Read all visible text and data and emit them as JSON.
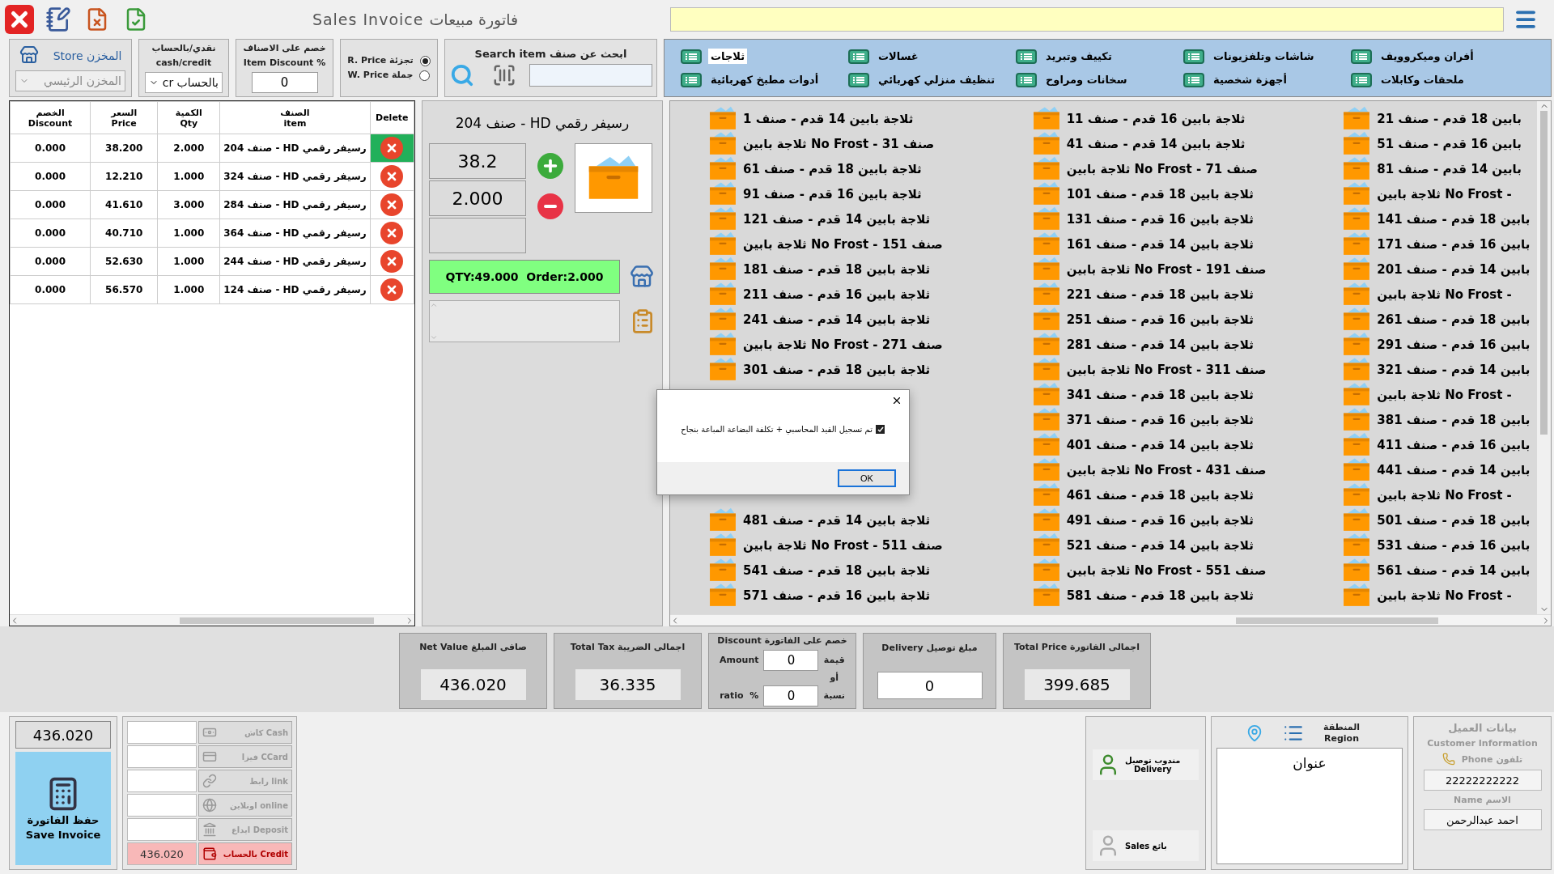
{
  "window": {
    "title": "Sales Invoice فاتورة مبيعات"
  },
  "store": {
    "label": "Store المخزن",
    "value": "المخزن الرئيسي",
    "disabled": true
  },
  "payment_type": {
    "label_ar": "نقدي/بالحساب",
    "label_en": "cash/credit",
    "value": "cr بالحساب"
  },
  "item_discount": {
    "label_ar": "خصم على الاصناف",
    "label_en": "Item Discount %",
    "value": "0"
  },
  "price_type": [
    {
      "label": "R. Price تجزئة",
      "selected": true
    },
    {
      "label": "W. Price جملة",
      "selected": false
    }
  ],
  "search": {
    "label": "Search item ابحث عن صنف"
  },
  "categories": [
    {
      "label": "أفران وميكروويف",
      "selected": false
    },
    {
      "label": "شاشات وتلفزيونات",
      "selected": false
    },
    {
      "label": "تكييف وتبريد",
      "selected": false
    },
    {
      "label": "غسالات",
      "selected": false
    },
    {
      "label": "ثلاجات",
      "selected": true
    },
    {
      "label": "ملحقات وكابلات",
      "selected": false
    },
    {
      "label": "أجهزة شخصية",
      "selected": false
    },
    {
      "label": "سخانات ومراوح",
      "selected": false
    },
    {
      "label": "تنظيف منزلي كهربائي",
      "selected": false
    },
    {
      "label": "أدوات مطبخ كهربائية",
      "selected": false
    }
  ],
  "table": {
    "columns": [
      {
        "en": "Delete"
      },
      {
        "ar": "الصنف",
        "en": "item"
      },
      {
        "ar": "الكمية",
        "en": "Qty"
      },
      {
        "ar": "السعر",
        "en": "Price"
      },
      {
        "ar": "الخصم",
        "en": "Discount"
      }
    ],
    "rows": [
      {
        "discount": "0.000",
        "price": "38.200",
        "qty": "2.000",
        "item": "رسيفر رقمي HD - صنف 204",
        "selected": true
      },
      {
        "discount": "0.000",
        "price": "12.210",
        "qty": "1.000",
        "item": "رسيفر رقمي HD - صنف 324",
        "selected": false
      },
      {
        "discount": "0.000",
        "price": "41.610",
        "qty": "3.000",
        "item": "رسيفر رقمي HD - صنف 284",
        "selected": false
      },
      {
        "discount": "0.000",
        "price": "40.710",
        "qty": "1.000",
        "item": "رسيفر رقمي HD - صنف 364",
        "selected": false
      },
      {
        "discount": "0.000",
        "price": "52.630",
        "qty": "1.000",
        "item": "رسيفر رقمي HD - صنف 244",
        "selected": false
      },
      {
        "discount": "0.000",
        "price": "56.570",
        "qty": "1.000",
        "item": "رسيفر رقمي HD - صنف 124",
        "selected": false
      }
    ]
  },
  "item_panel": {
    "title": "رسيفر رقمي HD - صنف 204",
    "price": "38.2",
    "qty": "2.000",
    "stock": "QTY:49.000  Order:2.000"
  },
  "products": {
    "column_1_top": [
      "ثلاجة بابين 14 قدم - صنف 1",
      "صنف No Frost - 31 ثلاجة بابين",
      "ثلاجة بابين 18 قدم - صنف 61",
      "ثلاجة بابين 16 قدم - صنف 91",
      "ثلاجة بابين 14 قدم - صنف 121",
      "صنف No Frost - 151 ثلاجة بابين",
      "ثلاجة بابين 18 قدم - صنف 181",
      "ثلاجة بابين 16 قدم - صنف 211",
      "ثلاجة بابين 14 قدم - صنف 241",
      "صنف No Frost - 271 ثلاجة بابين",
      "ثلاجة بابين 18 قدم - صنف 301"
    ],
    "column_1_bottom": [
      "ثلاجة بابين 14 قدم - صنف 481",
      "صنف No Frost - 511 ثلاجة بابين",
      "ثلاجة بابين 18 قدم - صنف 541",
      "ثلاجة بابين 16 قدم - صنف 571"
    ],
    "column_2": [
      "ثلاجة بابين 16 قدم - صنف 11",
      "ثلاجة بابين 14 قدم - صنف 41",
      "صنف No Frost - 71 ثلاجة بابين",
      "ثلاجة بابين 18 قدم - صنف 101",
      "ثلاجة بابين 16 قدم - صنف 131",
      "ثلاجة بابين 14 قدم - صنف 161",
      "صنف No Frost - 191 ثلاجة بابين",
      "ثلاجة بابين 18 قدم - صنف 221",
      "ثلاجة بابين 16 قدم - صنف 251",
      "ثلاجة بابين 14 قدم - صنف 281",
      "صنف No Frost - 311 ثلاجة بابين",
      "ثلاجة بابين 18 قدم - صنف 341",
      "ثلاجة بابين 16 قدم - صنف 371",
      "ثلاجة بابين 14 قدم - صنف 401",
      "صنف No Frost - 431 ثلاجة بابين",
      "ثلاجة بابين 18 قدم - صنف 461",
      "ثلاجة بابين 16 قدم - صنف 491",
      "ثلاجة بابين 14 قدم - صنف 521",
      "صنف No Frost - 551 ثلاجة بابين",
      "ثلاجة بابين 18 قدم - صنف 581"
    ],
    "column_3": [
      "بابين 18 قدم - صنف 21",
      "بابين 16 قدم - صنف 51",
      "بابين 14 قدم - صنف 81",
      "- No Frost ثلاجة بابين",
      "بابين 18 قدم - صنف 141",
      "بابين 16 قدم - صنف 171",
      "بابين 14 قدم - صنف 201",
      "- No Frost ثلاجة بابين",
      "بابين 18 قدم - صنف 261",
      "بابين 16 قدم - صنف 291",
      "بابين 14 قدم - صنف 321",
      "- No Frost ثلاجة بابين",
      "بابين 18 قدم - صنف 381",
      "بابين 16 قدم - صنف 411",
      "بابين 14 قدم - صنف 441",
      "- No Frost ثلاجة بابين",
      "بابين 18 قدم - صنف 501",
      "بابين 16 قدم - صنف 531",
      "بابين 14 قدم - صنف 561",
      "- No Frost ثلاجة بابين"
    ]
  },
  "dialog": {
    "message": "تم تسجيل القيد المحاسبي + تكلفة البضاعة المباعة بنجاح",
    "checked": true,
    "button": "OK"
  },
  "totals": {
    "net_value": {
      "label": "Net Value صافى المبلغ",
      "value": "436.020"
    },
    "total_tax": {
      "label": "Total Tax اجمالى الضريبة",
      "value": "36.335"
    },
    "discount": {
      "label": "Discount خصم على الفاتورة",
      "amount_label": "Amount",
      "amount": "0",
      "amount_ar": "قيمة",
      "or": "أو",
      "ratio_label": "ratio  %",
      "ratio": "0",
      "ratio_ar": "نسبة"
    },
    "delivery": {
      "label": "Delivery مبلغ توصيل",
      "value": "0"
    },
    "total_price": {
      "label": "Total Price اجمالى الفاتورة",
      "value": "399.685"
    }
  },
  "save": {
    "amount": "436.020",
    "label_ar": "حفظ الفاتورة",
    "label_en": "Save Invoice"
  },
  "payments": [
    {
      "label": "كاش Cash",
      "active": false
    },
    {
      "label": "فيزا CCard",
      "active": false
    },
    {
      "label": "رابط link",
      "active": false
    },
    {
      "label": "اونلاين online",
      "active": false
    },
    {
      "label": "ايداع Deposit",
      "active": false
    },
    {
      "label": "بالحساب Credit",
      "value": "436.020",
      "active": true
    }
  ],
  "delivery_person": {
    "label_ar": "مندوب توصيل",
    "label_en": "Delivery"
  },
  "sales_person": {
    "label": "Sales بائع"
  },
  "address": {
    "region_ar": "المنطقة",
    "region_en": "Region",
    "value": "عنوان"
  },
  "customer": {
    "title_ar": "بيانات العميل",
    "title_en": "Customer Information",
    "phone_label": "Phone تلفون",
    "phone": "22222222222",
    "name_label": "Name الاسم",
    "name": "احمد عبدالرحمن"
  }
}
